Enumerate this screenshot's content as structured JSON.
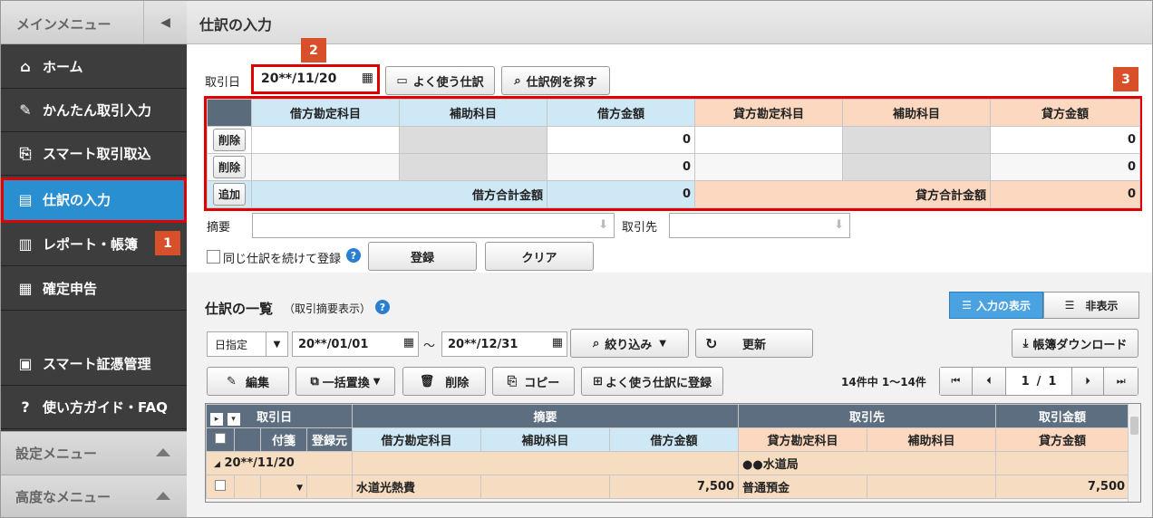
{
  "sidebar": {
    "header": "メインメニュー",
    "items": [
      {
        "label": "ホーム",
        "icon": "home-icon"
      },
      {
        "label": "かんたん取引入力",
        "icon": "pencil-icon"
      },
      {
        "label": "スマート取引取込",
        "icon": "import-icon"
      },
      {
        "label": "仕訳の入力",
        "icon": "journal-icon"
      },
      {
        "label": "レポート・帳簿",
        "icon": "report-icon"
      },
      {
        "label": "確定申告",
        "icon": "calculator-icon"
      },
      {
        "label": "スマート証憑管理",
        "icon": "voucher-icon"
      },
      {
        "label": "使い方ガイド・FAQ",
        "icon": "help-icon"
      }
    ],
    "sections": [
      "設定メニュー",
      "高度なメニュー"
    ]
  },
  "badges": {
    "b1": "1",
    "b2": "2",
    "b3": "3"
  },
  "page": {
    "title": "仕訳の入力"
  },
  "entry": {
    "date_label": "取引日",
    "date_value": "20**/11/20",
    "favorite_btn": "よく使う仕訳",
    "search_btn": "仕訳例を探す",
    "headers": [
      "借方勘定科目",
      "補助科目",
      "借方金額",
      "貸方勘定科目",
      "補助科目",
      "貸方金額"
    ],
    "delete_label": "削除",
    "add_label": "追加",
    "rows": [
      {
        "debit_amount": "0",
        "credit_amount": "0"
      },
      {
        "debit_amount": "0",
        "credit_amount": "0"
      }
    ],
    "debit_total_label": "借方合計金額",
    "debit_total": "0",
    "credit_total_label": "貸方合計金額",
    "credit_total": "0",
    "memo_label": "摘要",
    "partner_label": "取引先",
    "continue_label": "同じ仕訳を続けて登録",
    "register_btn": "登録",
    "clear_btn": "クリア"
  },
  "list": {
    "title": "仕訳の一覧",
    "subtitle": "（取引摘要表示）",
    "toggle_show": "入力の表示",
    "toggle_hide": "非表示",
    "period_type": "日指定",
    "date_from": "20**/01/01",
    "tilde": "～",
    "date_to": "20**/12/31",
    "filter_btn": "絞り込み",
    "refresh_btn": "更新",
    "download_btn": "帳簿ダウンロード",
    "edit_btn": "編集",
    "bulk_btn": "一括置換",
    "delete_btn": "削除",
    "copy_btn": "コピー",
    "fav_btn": "よく使う仕訳に登録",
    "count": "14件中 1～14件",
    "page_current": "1",
    "page_sep": "/",
    "page_total": "1",
    "headers": {
      "date": "取引日",
      "memo": "摘要",
      "partner": "取引先",
      "amount": "取引金額",
      "tag": "付箋",
      "source": "登録元",
      "debit_account": "借方勘定科目",
      "debit_sub": "補助科目",
      "debit_amount": "借方金額",
      "credit_account": "貸方勘定科目",
      "credit_sub": "補助科目",
      "credit_amount": "貸方金額"
    },
    "group_date": "20**/11/20",
    "group_partner": "●●水道局",
    "row": {
      "debit_account": "水道光熱費",
      "debit_amount": "7,500",
      "credit_account": "普通預金",
      "credit_amount": "7,500"
    }
  },
  "colors": {
    "accent": "#2a8fd0",
    "highlight": "#e00000",
    "badge": "#d7502a",
    "debit": "#cfe8f6",
    "credit": "#fbd8bf"
  }
}
